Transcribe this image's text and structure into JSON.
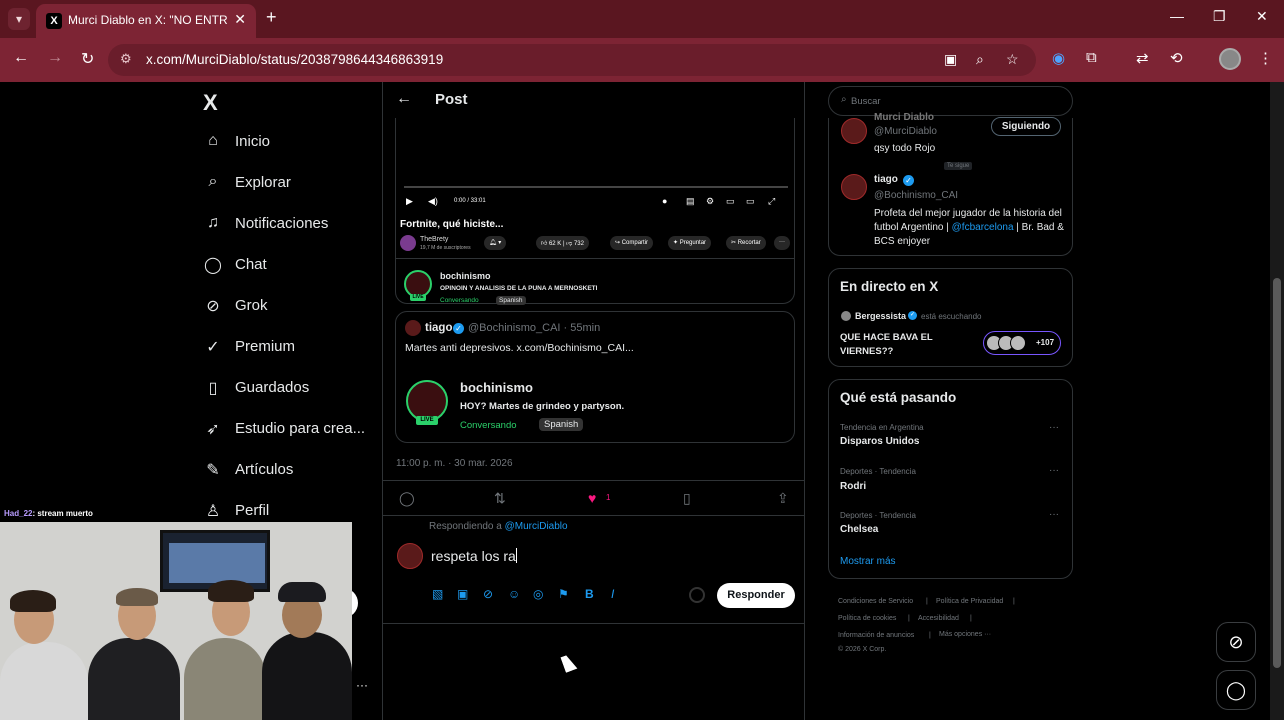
{
  "browser": {
    "tab_title": "Murci Diablo en X: \"NO ENTRE",
    "tab_favicon": "X",
    "url": "x.com/MurciDiablo/status/2038798644346863919"
  },
  "sidebar": {
    "logo": "X",
    "items": [
      {
        "label": "Inicio",
        "icon": "home-icon"
      },
      {
        "label": "Explorar",
        "icon": "search-icon"
      },
      {
        "label": "Notificaciones",
        "icon": "bell-icon"
      },
      {
        "label": "Chat",
        "icon": "chat-icon"
      },
      {
        "label": "Grok",
        "icon": "grok-icon"
      },
      {
        "label": "Premium",
        "icon": "premium-icon"
      },
      {
        "label": "Guardados",
        "icon": "bookmark-icon"
      },
      {
        "label": "Estudio para crea...",
        "icon": "rocket-icon"
      },
      {
        "label": "Artículos",
        "icon": "article-icon"
      },
      {
        "label": "Perfil",
        "icon": "profile-icon"
      }
    ]
  },
  "post": {
    "header_title": "Post",
    "video": {
      "time": "0:00 / 33:01",
      "title": "Fortnite, qué hiciste...",
      "channel": "TheBrety",
      "channel_sub": "19,7 M de suscriptores",
      "likes": "62 K",
      "dislikes": "732",
      "share": "Compartir",
      "ask": "Preguntar",
      "clip": "Recortar"
    },
    "embed1": {
      "name": "bochinismo",
      "desc": "OPINOIN Y ANALISIS DE LA PUNA A MERNOSKETI",
      "status": "Conversando",
      "lang": "Spanish",
      "live": "LIVE"
    },
    "quote": {
      "name": "tiago",
      "handle": "@Bochinismo_CAI · 55min",
      "text": "Martes anti depresivos.  x.com/Bochinismo_CAI...",
      "embed_name": "bochinismo",
      "embed_desc": "HOY? Martes de grindeo y partyson.",
      "embed_status": "Conversando",
      "embed_lang": "Spanish",
      "live": "LIVE"
    },
    "timestamp": "11:00 p. m. · 30 mar. 2026",
    "like_count": "1",
    "replying_prefix": "Respondiendo a ",
    "replying_handle": "@MurciDiablo",
    "composer_text": "respeta los ra",
    "reply_button": "Responder"
  },
  "right": {
    "search_placeholder": "Buscar",
    "who": [
      {
        "name": "Murci Diablo",
        "handle": "@MurciDiablo",
        "follows_you": "Te sigue",
        "bio": "qsy todo Rojo",
        "button": "Siguiendo"
      },
      {
        "name": "tiago",
        "handle": "@Bochinismo_CAI",
        "bio_lines": [
          "Profeta del mejor jugador de la historia",
          "del futbol Argentino | ",
          "@fcbarcelona",
          " | Br.",
          "Bad & BCS enjoyer"
        ]
      }
    ],
    "live": {
      "title": "En directo en X",
      "host": "Bergessista",
      "listening": "está escuchando",
      "topic": "QUE HACE BAVA EL VIERNES??",
      "listeners": "+107"
    },
    "trends": {
      "title": "Qué está pasando",
      "items": [
        {
          "meta": "Tendencia en Argentina",
          "name": "Disparos Unidos"
        },
        {
          "meta": "Deportes · Tendencia",
          "name": "Rodri"
        },
        {
          "meta": "Deportes · Tendencia",
          "name": "Chelsea"
        }
      ],
      "show_more": "Mostrar más"
    },
    "footer": [
      "Condiciones de Servicio",
      "|",
      "Política de Privacidad",
      "|",
      "Política de cookies",
      "|",
      "Accesibilidad",
      "|",
      "Información de anuncios",
      "|",
      "Más opciones ···",
      "© 2026 X Corp."
    ]
  },
  "stream": {
    "chat_user": "Had_22",
    "chat_message": ": stream muerto"
  },
  "colors": {
    "browser_frame": "#7d2434",
    "x_blue": "#1d9bf0",
    "like_pink": "#f91880",
    "live_green": "#2bd06a",
    "spaces_purple": "#7856ff"
  }
}
